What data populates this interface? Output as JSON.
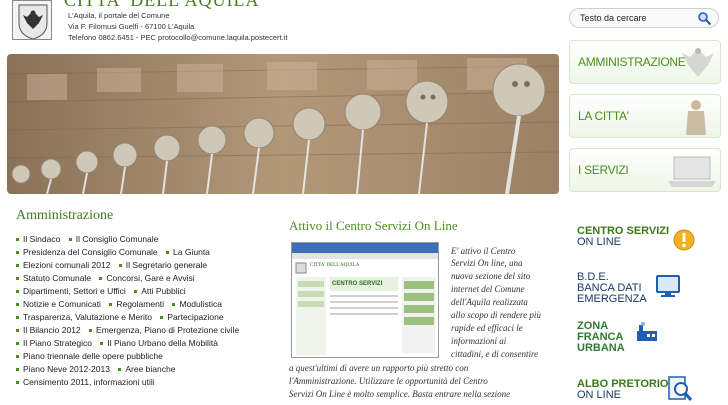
{
  "header": {
    "title": "CITTA' DELL'AQUILA",
    "tagline": "L'Aquila, il portale del Comune",
    "address": "Via F. Filomusi Guelfi - 67100 L'Aquila",
    "contacts": "Telefono  0862.6451 - PEC protocollo@comune.laquila.postecert.it"
  },
  "search": {
    "placeholder": "Testo da cercare",
    "icon": "search-icon"
  },
  "side_menu": [
    {
      "label": "AMMINISTRAZIONE",
      "icon": "eagle-icon"
    },
    {
      "label": "LA CITTA'",
      "icon": "statue-icon"
    },
    {
      "label": "I SERVIZI",
      "icon": "laptop-icon"
    }
  ],
  "administration": {
    "title": "Amministrazione",
    "rows": [
      [
        "Il Sindaco",
        "Il Consiglio Comunale"
      ],
      [
        "Presidenza del Consiglio Comunale",
        "La Giunta"
      ],
      [
        "Elezioni comunali 2012",
        "Il Segretario generale"
      ],
      [
        "Statuto Comunale",
        "Concorsi, Gare e Avvisi"
      ],
      [
        "Dipartimenti, Settori e Uffici",
        "Atti Pubblici"
      ],
      [
        "Notizie e Comunicati",
        "Regolamenti",
        "Modulistica"
      ],
      [
        "Trasparenza, Valutazione e Merito",
        "Partecipazione"
      ],
      [
        "Il Bilancio 2012",
        "Emergenza, Piano di Protezione civile"
      ],
      [
        "Il Piano Strategico",
        "Il Piano Urbano della Mobilità"
      ],
      [
        "Piano triennale delle opere pubbliche"
      ],
      [
        "Piano Neve 2012-2013",
        "Aree bianche"
      ],
      [
        "Censimento 2011, informazioni utili"
      ]
    ]
  },
  "news": {
    "title": "Attivo il Centro Servizi On Line",
    "thumb": {
      "site_name": "CITTA' DELL'AQUILA",
      "heading": "CENTRO SERVIZI"
    },
    "side_lines": [
      "E' attivo il Centro",
      "Servizi On line, una",
      "nuova sezione del sito",
      "internet del Comune",
      "dell'Aquila realizzata",
      "allo scopo di rendere più",
      "rapide ed efficaci le",
      "informazioni ai",
      "cittadini, e di consentire"
    ],
    "full_lines": [
      "a quest'ultimi di avere un rapporto più stretto con",
      "l'Amministrazione. Utilizzare le opportunità del Centro",
      "Servizi On Line è molto semplice. Basta entrare nella sezione"
    ]
  },
  "services": [
    {
      "title": "CENTRO SERVIZI",
      "sub": "ON LINE",
      "icon": "info-icon"
    },
    {
      "title": "B.D.E.",
      "sub": "BANCA DATI",
      "sub2": "EMERGENZA",
      "icon": "monitor-icon"
    },
    {
      "title": "ZONA",
      "sub": "FRANCA",
      "sub2": "URBANA",
      "icon": "factory-icon"
    },
    {
      "title": "ALBO PRETORIO",
      "sub": "ON LINE",
      "icon": "magnifier-icon"
    }
  ],
  "colors": {
    "accent_green": "#4a8f1e",
    "dark_blue": "#163a6a",
    "stone": "#a88c6c"
  }
}
